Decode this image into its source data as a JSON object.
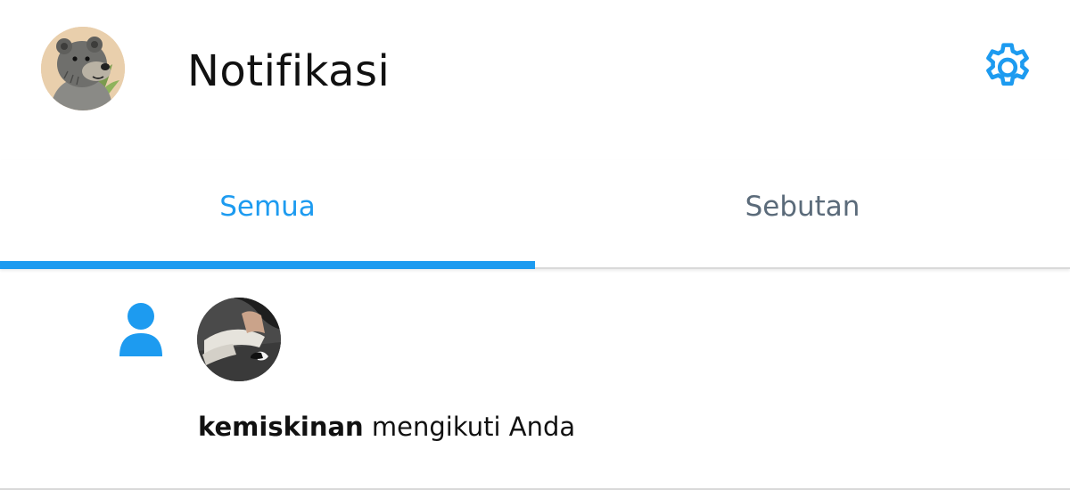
{
  "header": {
    "title": "Notifikasi",
    "avatar_icon": "bear-avatar",
    "settings_icon": "gear-icon"
  },
  "tabs": [
    {
      "label": "Semua",
      "active": true
    },
    {
      "label": "Sebutan",
      "active": false
    }
  ],
  "notifications": [
    {
      "type_icon": "person-icon",
      "username": "kemiskinan",
      "action_text": " mengikuti Anda"
    }
  ],
  "colors": {
    "accent": "#1d9bf0",
    "inactive_tab": "#5b6b7a",
    "text": "#111111",
    "divider": "#d9d9d9"
  }
}
